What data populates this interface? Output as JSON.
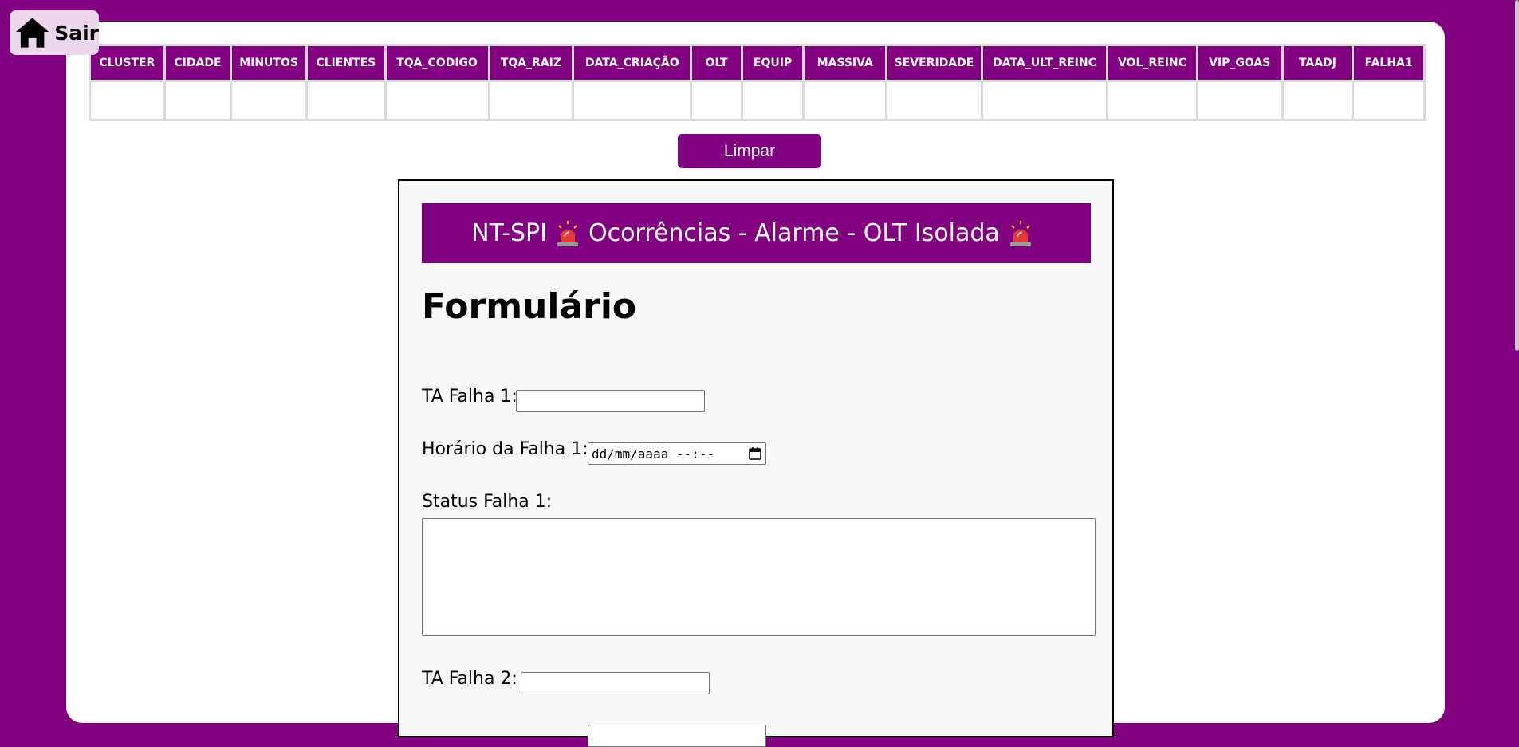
{
  "home": {
    "label": "Sair",
    "icon": "home-icon"
  },
  "table": {
    "headers": [
      "CLUSTER",
      "CIDADE",
      "MINUTOS",
      "CLIENTES",
      "TQA_CODIGO",
      "TQA_RAIZ",
      "DATA_CRIAÇÃO",
      "OLT",
      "EQUIP",
      "MASSIVA",
      "SEVERIDADE",
      "DATA_ULT_REINC",
      "VOL_REINC",
      "VIP_GOAS",
      "TAADJ",
      "FALHA1"
    ],
    "rows": [
      [
        "",
        "",
        "",
        "",
        "",
        "",
        "",
        "",
        "",
        "",
        "",
        "",
        "",
        "",
        "",
        ""
      ]
    ]
  },
  "limpar_label": "Limpar",
  "form": {
    "banner_text": "NT-SPI 🚨 Ocorrências - Alarme - OLT Isolada 🚨",
    "banner_prefix": "NT-SPI",
    "banner_middle": "Ocorrências - Alarme - OLT Isolada",
    "banner_icon": "siren-icon",
    "title": "Formulário",
    "ta_falha_1_label": "TA Falha 1:",
    "ta_falha_1_value": "",
    "horario_falha_1_label": "Horário da Falha 1:",
    "horario_falha_1_placeholder": "dd/mm/aaaa --:--",
    "status_falha_1_label": "Status Falha 1:",
    "status_falha_1_value": "",
    "ta_falha_2_label": "TA Falha 2:",
    "ta_falha_2_value": ""
  },
  "colors": {
    "brand": "#800080",
    "panel": "#ffffff",
    "form_bg": "#f7f7f7"
  }
}
